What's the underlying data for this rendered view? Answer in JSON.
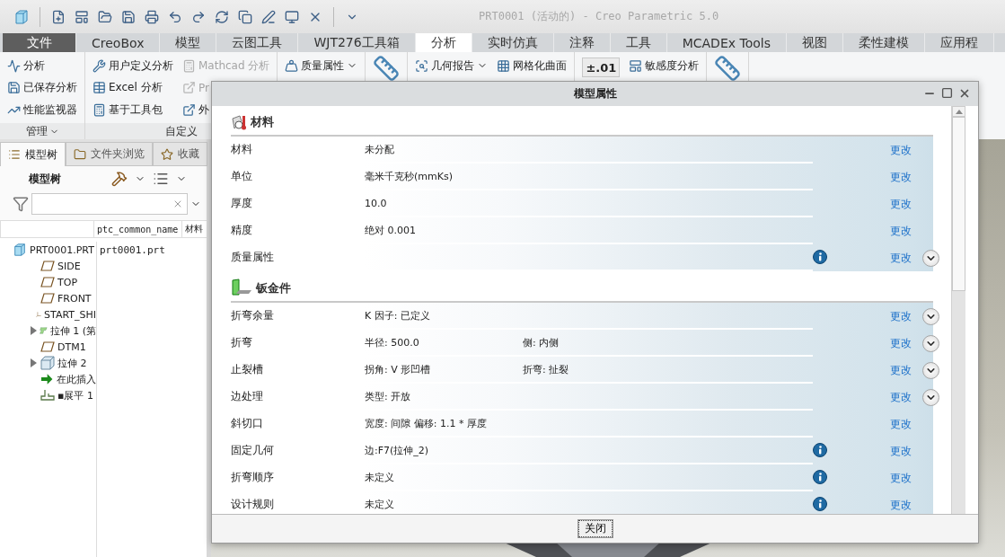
{
  "window": {
    "title": "PRT0001 (活动的) - Creo Parametric 5.0"
  },
  "ribbon_tabs": [
    {
      "label": "文件",
      "kind": "file",
      "selected": false
    },
    {
      "label": "CreoBox",
      "kind": "tab",
      "selected": false
    },
    {
      "label": "模型",
      "kind": "tab",
      "selected": false
    },
    {
      "label": "云图工具",
      "kind": "tab",
      "selected": false
    },
    {
      "label": "WJT276工具箱",
      "kind": "tab",
      "selected": false
    },
    {
      "label": "分析",
      "kind": "tab",
      "selected": true
    },
    {
      "label": "实时仿真",
      "kind": "tab",
      "selected": false
    },
    {
      "label": "注释",
      "kind": "tab",
      "selected": false
    },
    {
      "label": "工具",
      "kind": "tab",
      "selected": false
    },
    {
      "label": "MCADEx Tools",
      "kind": "tab",
      "selected": false
    },
    {
      "label": "视图",
      "kind": "tab",
      "selected": false
    },
    {
      "label": "柔性建模",
      "kind": "tab",
      "selected": false
    },
    {
      "label": "应用程",
      "kind": "tab",
      "selected": false
    }
  ],
  "ribbon": {
    "groups": [
      {
        "label": "管理",
        "menu": true,
        "columns": [
          [
            {
              "kind": "command",
              "label": "分析",
              "disabled": false,
              "menu": false
            },
            {
              "kind": "command",
              "label": "已保存分析",
              "disabled": false,
              "menu": false
            },
            {
              "kind": "command",
              "label": "性能监视器",
              "disabled": false,
              "menu": false
            }
          ]
        ]
      },
      {
        "label": "自定义",
        "columns": [
          [
            {
              "kind": "command",
              "label": "用户定义分析",
              "disabled": false,
              "menu": false
            },
            {
              "kind": "command",
              "label": "Excel 分析",
              "disabled": false,
              "menu": false
            },
            {
              "kind": "command",
              "label": "基于工具包",
              "disabled": false,
              "menu": false
            }
          ],
          [
            {
              "kind": "command",
              "label": "Mathcad 分析",
              "disabled": true,
              "menu": false
            },
            {
              "kind": "command",
              "label": "Pr",
              "disabled": true,
              "menu": false
            },
            {
              "kind": "command",
              "label": "外",
              "disabled": false,
              "menu": false
            }
          ]
        ]
      },
      {
        "columns": [
          [
            {
              "kind": "command",
              "label": "质量属性",
              "disabled": false,
              "menu": true
            }
          ]
        ]
      },
      {
        "columns": [
          [
            {
              "kind": "large_icon"
            }
          ]
        ]
      },
      {
        "columns": [
          [
            {
              "kind": "command",
              "label": "几何报告",
              "disabled": false,
              "menu": true
            }
          ],
          [
            {
              "kind": "command",
              "label": "网格化曲面",
              "disabled": false,
              "menu": false
            }
          ]
        ]
      },
      {
        "columns": [
          [
            {
              "kind": "button",
              "label": "±.01"
            }
          ],
          [
            {
              "kind": "command",
              "label": "敏感度分析",
              "disabled": false,
              "menu": false
            }
          ]
        ]
      },
      {
        "columns": [
          [
            {
              "kind": "large_icon"
            }
          ]
        ]
      }
    ]
  },
  "model_tree": {
    "tabs": [
      {
        "label": "模型树",
        "selected": true
      },
      {
        "label": "文件夹浏览",
        "selected": false
      },
      {
        "label": "收藏",
        "selected": false
      }
    ],
    "title": "模型树",
    "columns": [
      "ptc_common_name",
      "材料"
    ],
    "tree": [
      {
        "label": "PRT0001.PRT",
        "kind": "part",
        "cells": [
          "prt0001.prt"
        ],
        "children": [
          {
            "label": "SIDE",
            "kind": "plane",
            "expandable": false
          },
          {
            "label": "TOP",
            "kind": "plane",
            "expandable": false
          },
          {
            "label": "FRONT",
            "kind": "plane",
            "expandable": false
          },
          {
            "label": "START_SHI",
            "kind": "csys",
            "expandable": false
          },
          {
            "label": "拉伸 1 (第",
            "kind": "surface",
            "expandable": true
          },
          {
            "label": "DTM1",
            "kind": "plane",
            "expandable": false
          },
          {
            "label": "拉伸 2",
            "kind": "solid",
            "expandable": true
          },
          {
            "label": "在此插入",
            "kind": "insert",
            "expandable": false
          },
          {
            "label": "▪展平 1",
            "kind": "flatten",
            "expandable": false
          }
        ]
      }
    ]
  },
  "dialog": {
    "title": "模型属性",
    "sections": [
      {
        "title": "材料",
        "kind": "material",
        "rows": [
          {
            "label": "材料",
            "values": [
              "未分配"
            ],
            "info": false,
            "action": "更改",
            "expand_button": false
          },
          {
            "label": "单位",
            "values": [
              "毫米千克秒(mmKs)"
            ],
            "info": false,
            "action": "更改",
            "expand_button": false
          },
          {
            "label": "厚度",
            "values": [
              "10.0"
            ],
            "info": false,
            "action": "更改",
            "expand_button": false
          },
          {
            "label": "精度",
            "values": [
              "绝对 0.001"
            ],
            "info": false,
            "action": "更改",
            "expand_button": false
          },
          {
            "label": "质量属性",
            "values": [],
            "info": true,
            "action": "更改",
            "expand_button": true
          }
        ]
      },
      {
        "title": "钣金件",
        "kind": "sheetmetal",
        "rows": [
          {
            "label": "折弯余量",
            "values": [
              "K 因子: 已定义"
            ],
            "info": false,
            "action": "更改",
            "expand_button": true
          },
          {
            "label": "折弯",
            "values": [
              "半径: 500.0",
              "侧: 内侧"
            ],
            "info": false,
            "action": "更改",
            "expand_button": true
          },
          {
            "label": "止裂槽",
            "values": [
              "拐角: V 形凹槽",
              "折弯: 扯裂"
            ],
            "info": false,
            "action": "更改",
            "expand_button": true
          },
          {
            "label": "边处理",
            "values": [
              "类型: 开放"
            ],
            "info": false,
            "action": "更改",
            "expand_button": true
          },
          {
            "label": "斜切口",
            "values": [
              "宽度: 间隙 偏移: 1.1 * 厚度"
            ],
            "info": false,
            "action": "更改",
            "expand_button": false
          },
          {
            "label": "固定几何",
            "values": [
              "边:F7(拉伸_2)"
            ],
            "info": true,
            "action": "更改",
            "expand_button": false
          },
          {
            "label": "折弯顺序",
            "values": [
              "未定义"
            ],
            "info": true,
            "action": "更改",
            "expand_button": false
          },
          {
            "label": "设计规则",
            "values": [
              "未定义"
            ],
            "info": true,
            "action": "更改",
            "expand_button": false
          }
        ]
      }
    ],
    "close_button": "关闭"
  }
}
